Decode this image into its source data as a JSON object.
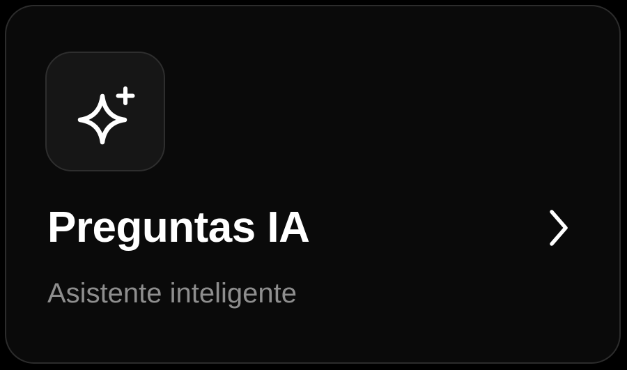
{
  "card": {
    "title": "Preguntas IA",
    "subtitle": "Asistente inteligente",
    "icon": "sparkle-icon",
    "action_icon": "chevron-right-icon"
  },
  "colors": {
    "background": "#000000",
    "card": "#0a0a0a",
    "card_border": "#2c2c2c",
    "icon_tile": "#161616",
    "title": "#ffffff",
    "subtitle": "#8e8e8e"
  }
}
